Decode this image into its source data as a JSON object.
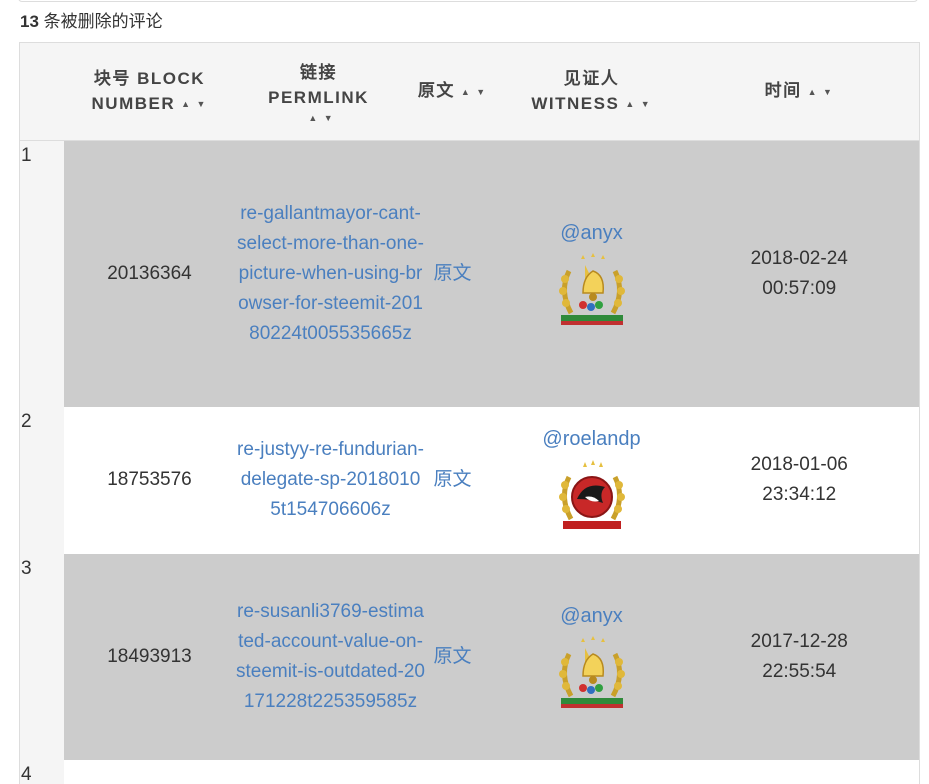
{
  "caption": {
    "count": "13",
    "text": " 条被删除的评论"
  },
  "table": {
    "headers": {
      "index": "",
      "block_line1": "块号 BLOCK",
      "block_line2": "NUMBER",
      "permlink_line1": "链接",
      "permlink_line2": "PERMLINK",
      "original": "原文",
      "witness_line1": "见证人",
      "witness_line2": "WITNESS",
      "time": "时间",
      "sort_glyph": "▲ ▼"
    },
    "rows": [
      {
        "index": "1",
        "block": "20136364",
        "permlink": "re-gallantmayor-cant-select-more-than-one-picture-when-using-browser-for-steemit-20180224t005535665z",
        "original": "原文",
        "witness": "@anyx",
        "witness_icon": "laurel-bell-badge-icon",
        "date": "2018-02-24",
        "time": "00:57:09"
      },
      {
        "index": "2",
        "block": "18753576",
        "permlink": "re-justyy-re-fundurian-delegate-sp-20180105t154706606z",
        "original": "原文",
        "witness": "@roelandp",
        "witness_icon": "laurel-orca-badge-icon",
        "date": "2018-01-06",
        "time": "23:34:12"
      },
      {
        "index": "3",
        "block": "18493913",
        "permlink": "re-susanli3769-estimated-account-value-on-steemit-is-outdated-20171228t225359585z",
        "original": "原文",
        "witness": "@anyx",
        "witness_icon": "laurel-bell-badge-icon",
        "date": "2017-12-28",
        "time": "22:55:54"
      },
      {
        "index": "4",
        "block": "",
        "permlink": "",
        "original": "",
        "witness": "",
        "date": "",
        "time": ""
      }
    ]
  },
  "colors": {
    "link": "#4a7fbf",
    "shaded_row": "#cccccc",
    "header_bg": "#f5f5f5",
    "border": "#dddddd"
  }
}
